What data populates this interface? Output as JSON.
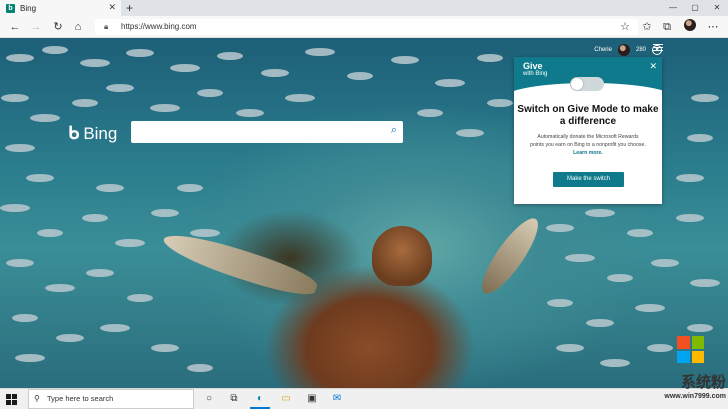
{
  "browser": {
    "tab_title": "Bing",
    "favicon_letter": "b",
    "url": "https://www.bing.com",
    "new_tab_symbol": "+",
    "window_controls": [
      "—",
      "▢",
      "✕"
    ]
  },
  "bing": {
    "logo_text": "Bing",
    "user_name": "Cherie",
    "reward_points": "280",
    "search_value": ""
  },
  "give_card": {
    "brand_title": "Give",
    "brand_sub": "with Bing",
    "heading": "Switch on Give Mode to make a difference",
    "body": "Automatically donate the Microsoft Rewards points you earn on Bing to a nonprofit you choose.",
    "learn_more": "Learn more.",
    "button_label": "Make the switch",
    "toggle_on": false
  },
  "taskbar": {
    "search_placeholder": "Type here to search"
  },
  "watermark": {
    "brand": "系统粉",
    "url": "www.win7999.com"
  },
  "colors": {
    "accent": "#0e7a8c",
    "taskbar_active": "#0078d7",
    "ms_red": "#f25022",
    "ms_green": "#7fba00",
    "ms_blue": "#00a4ef",
    "ms_yellow": "#ffb900"
  }
}
